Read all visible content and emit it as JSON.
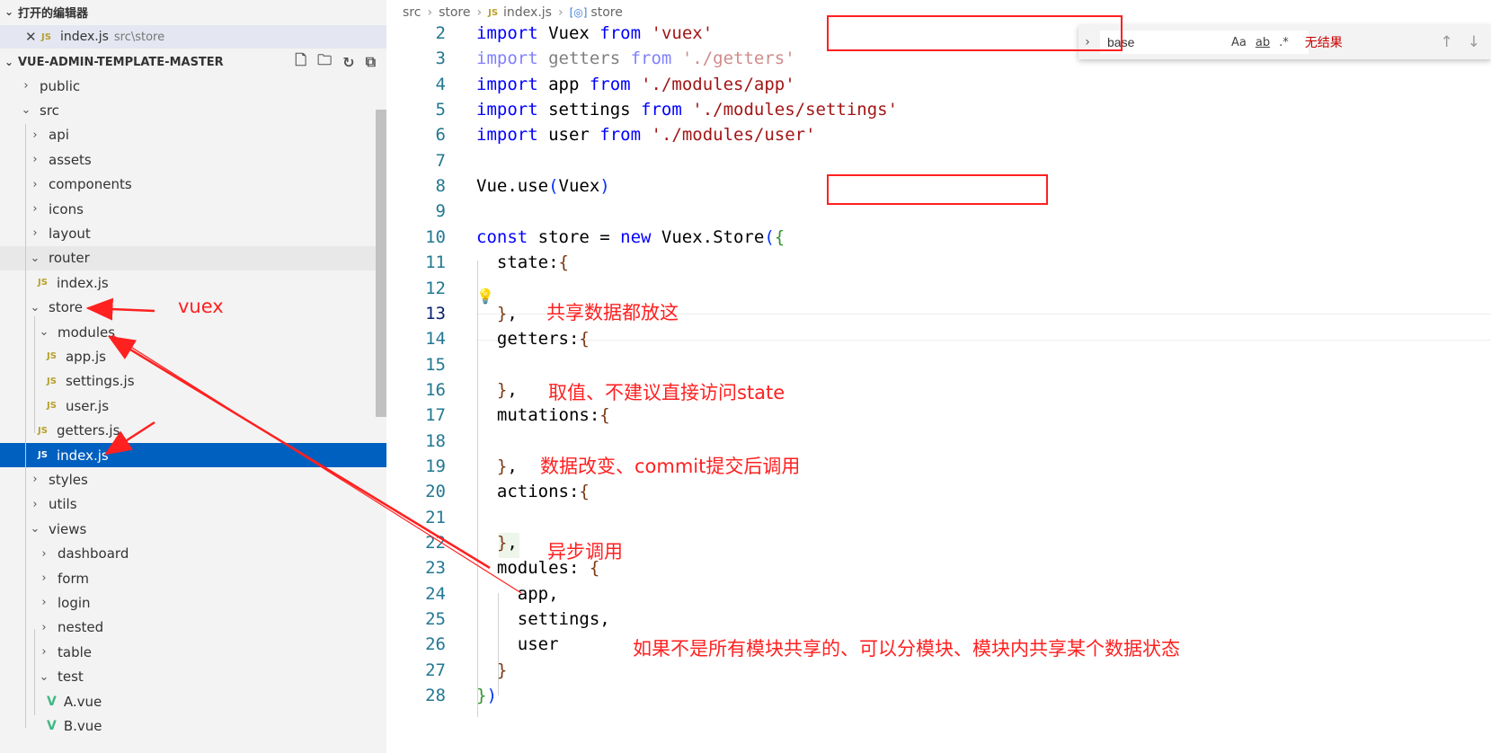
{
  "sidebar": {
    "open_editors_title": "打开的编辑器",
    "open_editor": {
      "icon": "JS",
      "name": "index.js",
      "path": "src\\store"
    },
    "project_title": "VUE-ADMIN-TEMPLATE-MASTER",
    "project_actions": [
      "new-file-icon",
      "new-folder-icon",
      "refresh-icon",
      "collapse-all-icon"
    ],
    "tree": [
      {
        "label": "public",
        "type": "folder",
        "expanded": false
      },
      {
        "label": "src",
        "type": "folder",
        "expanded": true
      },
      {
        "label": "api",
        "type": "folder",
        "expanded": false
      },
      {
        "label": "assets",
        "type": "folder",
        "expanded": false
      },
      {
        "label": "components",
        "type": "folder",
        "expanded": false
      },
      {
        "label": "icons",
        "type": "folder",
        "expanded": false
      },
      {
        "label": "layout",
        "type": "folder",
        "expanded": false
      },
      {
        "label": "router",
        "type": "folder",
        "expanded": true
      },
      {
        "label": "index.js",
        "type": "file",
        "icon": "JS"
      },
      {
        "label": "store",
        "type": "folder",
        "expanded": true
      },
      {
        "label": "modules",
        "type": "folder",
        "expanded": true
      },
      {
        "label": "app.js",
        "type": "file",
        "icon": "JS"
      },
      {
        "label": "settings.js",
        "type": "file",
        "icon": "JS"
      },
      {
        "label": "user.js",
        "type": "file",
        "icon": "JS"
      },
      {
        "label": "getters.js",
        "type": "file",
        "icon": "JS"
      },
      {
        "label": "index.js",
        "type": "file",
        "icon": "JS",
        "selected": true
      },
      {
        "label": "styles",
        "type": "folder",
        "expanded": false
      },
      {
        "label": "utils",
        "type": "folder",
        "expanded": false
      },
      {
        "label": "views",
        "type": "folder",
        "expanded": true
      },
      {
        "label": "dashboard",
        "type": "folder",
        "expanded": false
      },
      {
        "label": "form",
        "type": "folder",
        "expanded": false
      },
      {
        "label": "login",
        "type": "folder",
        "expanded": false
      },
      {
        "label": "nested",
        "type": "folder",
        "expanded": false
      },
      {
        "label": "table",
        "type": "folder",
        "expanded": false
      },
      {
        "label": "test",
        "type": "folder",
        "expanded": true
      },
      {
        "label": "A.vue",
        "type": "file",
        "icon": "V"
      },
      {
        "label": "B.vue",
        "type": "file",
        "icon": "V"
      }
    ]
  },
  "breadcrumb": [
    "src",
    "store",
    "JS",
    "index.js",
    "store"
  ],
  "find": {
    "value": "base",
    "options": [
      "Aa",
      "ab",
      ".*"
    ],
    "status": "无结果",
    "nav_icons": [
      "arrow-up-icon",
      "arrow-down-icon"
    ]
  },
  "editor": {
    "current_line": 13,
    "lines": [
      {
        "n": 2,
        "tokens": [
          {
            "t": "import",
            "c": "kw"
          },
          {
            "t": " Vuex "
          },
          {
            "t": "from",
            "c": "kw"
          },
          {
            "t": " "
          },
          {
            "t": "'vuex'",
            "c": "str"
          }
        ]
      },
      {
        "n": 3,
        "faded": true,
        "tokens": [
          {
            "t": "import",
            "c": "kw"
          },
          {
            "t": " getters "
          },
          {
            "t": "from",
            "c": "kw"
          },
          {
            "t": " "
          },
          {
            "t": "'./getters'",
            "c": "str"
          }
        ]
      },
      {
        "n": 4,
        "tokens": [
          {
            "t": "import",
            "c": "kw"
          },
          {
            "t": " app "
          },
          {
            "t": "from",
            "c": "kw"
          },
          {
            "t": " "
          },
          {
            "t": "'./modules/app'",
            "c": "str"
          }
        ]
      },
      {
        "n": 5,
        "tokens": [
          {
            "t": "import",
            "c": "kw"
          },
          {
            "t": " settings "
          },
          {
            "t": "from",
            "c": "kw"
          },
          {
            "t": " "
          },
          {
            "t": "'./modules/settings'",
            "c": "str"
          }
        ]
      },
      {
        "n": 6,
        "tokens": [
          {
            "t": "import",
            "c": "kw"
          },
          {
            "t": " user "
          },
          {
            "t": "from",
            "c": "kw"
          },
          {
            "t": " "
          },
          {
            "t": "'./modules/user'",
            "c": "str"
          }
        ]
      },
      {
        "n": 7,
        "tokens": []
      },
      {
        "n": 8,
        "tokens": [
          {
            "t": "Vue.use"
          },
          {
            "t": "(",
            "c": "br1"
          },
          {
            "t": "Vuex"
          },
          {
            "t": ")",
            "c": "br1"
          }
        ]
      },
      {
        "n": 9,
        "tokens": []
      },
      {
        "n": 10,
        "tokens": [
          {
            "t": "const",
            "c": "kw"
          },
          {
            "t": " store = "
          },
          {
            "t": "new",
            "c": "kw"
          },
          {
            "t": " Vuex.Store"
          },
          {
            "t": "(",
            "c": "br1"
          },
          {
            "t": "{",
            "c": "br2"
          }
        ]
      },
      {
        "n": 11,
        "tokens": [
          {
            "t": "  state:"
          },
          {
            "t": "{",
            "c": "br3"
          }
        ]
      },
      {
        "n": 12,
        "tokens": []
      },
      {
        "n": 13,
        "tokens": [
          {
            "t": "  "
          },
          {
            "t": "}",
            "c": "br3"
          },
          {
            "t": ","
          }
        ]
      },
      {
        "n": 14,
        "tokens": [
          {
            "t": "  getters:"
          },
          {
            "t": "{",
            "c": "br3"
          }
        ]
      },
      {
        "n": 15,
        "tokens": []
      },
      {
        "n": 16,
        "tokens": [
          {
            "t": "  "
          },
          {
            "t": "}",
            "c": "br3"
          },
          {
            "t": ","
          }
        ]
      },
      {
        "n": 17,
        "tokens": [
          {
            "t": "  mutations:"
          },
          {
            "t": "{",
            "c": "br3"
          }
        ]
      },
      {
        "n": 18,
        "tokens": []
      },
      {
        "n": 19,
        "tokens": [
          {
            "t": "  "
          },
          {
            "t": "}",
            "c": "br3"
          },
          {
            "t": ","
          }
        ]
      },
      {
        "n": 20,
        "tokens": [
          {
            "t": "  actions:"
          },
          {
            "t": "{",
            "c": "br3"
          }
        ]
      },
      {
        "n": 21,
        "tokens": []
      },
      {
        "n": 22,
        "tokens": [
          {
            "t": "  "
          },
          {
            "t": "}",
            "c": "br3"
          },
          {
            "t": ","
          }
        ]
      },
      {
        "n": 23,
        "tokens": [
          {
            "t": "  modules: "
          },
          {
            "t": "{",
            "c": "br3"
          }
        ]
      },
      {
        "n": 24,
        "tokens": [
          {
            "t": "    app,"
          }
        ]
      },
      {
        "n": 25,
        "tokens": [
          {
            "t": "    settings,"
          }
        ]
      },
      {
        "n": 26,
        "tokens": [
          {
            "t": "    user"
          }
        ]
      },
      {
        "n": 27,
        "tokens": [
          {
            "t": "  "
          },
          {
            "t": "}",
            "c": "br3"
          }
        ]
      },
      {
        "n": 28,
        "tokens": [
          {
            "t": "}",
            "c": "br2"
          },
          {
            "t": ")",
            "c": "br1"
          }
        ]
      }
    ]
  },
  "annotations": {
    "vuex_label": "vuex",
    "state_note": "共享数据都放这",
    "getters_note": "取值、不建议直接访问state",
    "mutations_note": "数据改变、commit提交后调用",
    "actions_note": "异步调用",
    "modules_note": "如果不是所有模块共享的、可以分模块、模块内共享某个数据状态",
    "color": "#ff2020"
  }
}
